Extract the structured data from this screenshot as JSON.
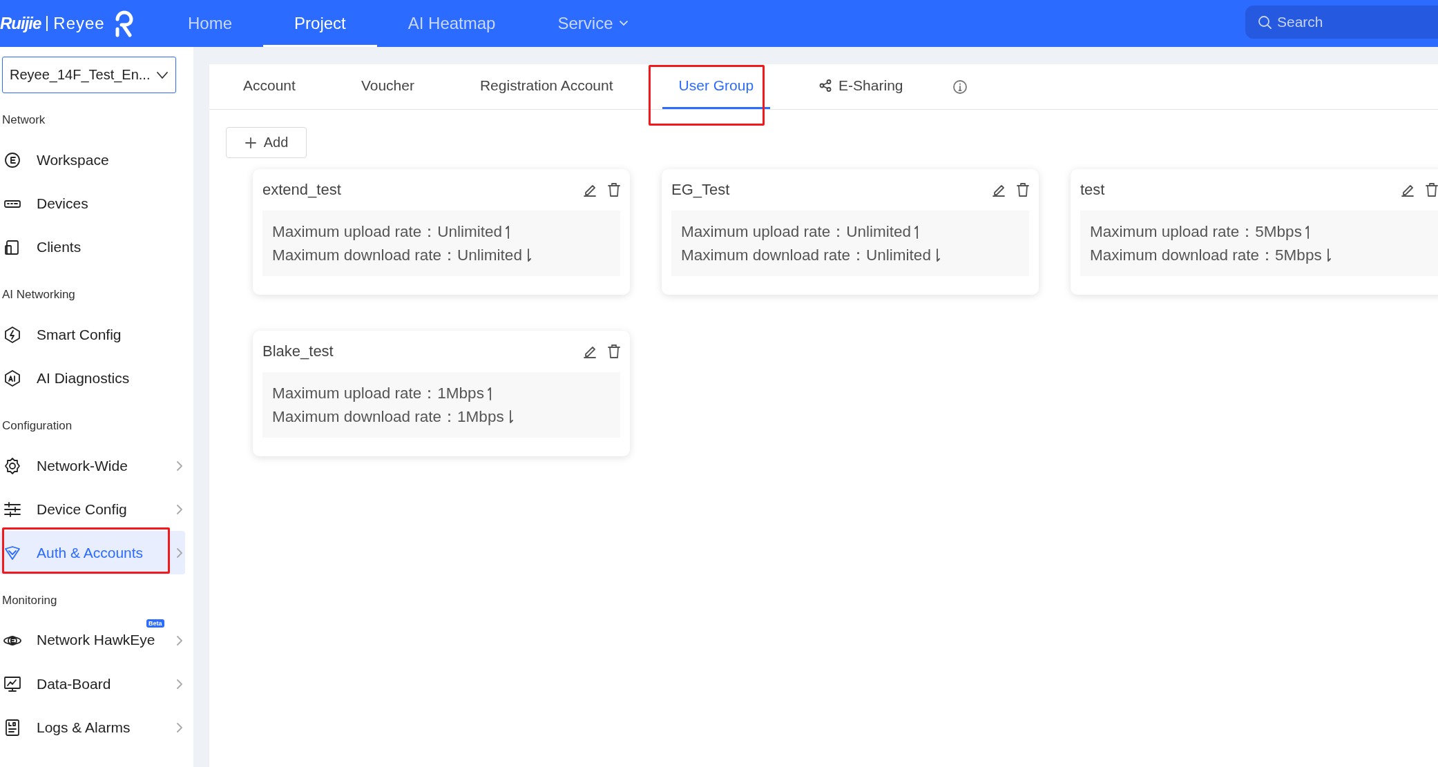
{
  "logo": {
    "brand": "Ruijie",
    "product": "Reyee"
  },
  "nav": [
    {
      "label": "Home",
      "selected": false,
      "kind": "link"
    },
    {
      "label": "Project",
      "selected": true,
      "kind": "link"
    },
    {
      "label": "AI Heatmap",
      "selected": false,
      "kind": "link"
    },
    {
      "label": "Service",
      "selected": false,
      "kind": "menu"
    }
  ],
  "search": {
    "placeholder": "Search"
  },
  "project_select": {
    "value": "Reyee_14F_Test_En..."
  },
  "sidebar": [
    {
      "section": "Network",
      "items": [
        {
          "label": "Workspace",
          "selected": false,
          "expandable": false,
          "annotated": false
        },
        {
          "label": "Devices",
          "selected": false,
          "expandable": false,
          "annotated": false
        },
        {
          "label": "Clients",
          "selected": false,
          "expandable": false,
          "annotated": false
        }
      ]
    },
    {
      "section": "AI Networking",
      "items": [
        {
          "label": "Smart Config",
          "selected": false,
          "expandable": false,
          "annotated": false
        },
        {
          "label": "AI Diagnostics",
          "selected": false,
          "expandable": false,
          "annotated": false
        }
      ]
    },
    {
      "section": "Configuration",
      "items": [
        {
          "label": "Network-Wide",
          "selected": false,
          "expandable": true,
          "annotated": false
        },
        {
          "label": "Device Config",
          "selected": false,
          "expandable": true,
          "annotated": false
        },
        {
          "label": "Auth & Accounts",
          "selected": true,
          "expandable": true,
          "annotated": true
        }
      ]
    },
    {
      "section": "Monitoring",
      "items": [
        {
          "label": "Network HawkEye",
          "selected": false,
          "expandable": true,
          "annotated": false,
          "badge": "Beta"
        },
        {
          "label": "Data-Board",
          "selected": false,
          "expandable": true,
          "annotated": false
        },
        {
          "label": "Logs & Alarms",
          "selected": false,
          "expandable": true,
          "annotated": false
        }
      ]
    }
  ],
  "tabs": [
    {
      "label": "Account",
      "selected": false,
      "annotated": false
    },
    {
      "label": "Voucher",
      "selected": false,
      "annotated": false
    },
    {
      "label": "Registration Account",
      "selected": false,
      "annotated": false
    },
    {
      "label": "User Group",
      "selected": true,
      "annotated": true
    },
    {
      "label": "E-Sharing",
      "selected": false,
      "annotated": false
    }
  ],
  "add_button": {
    "label": "Add"
  },
  "groups": [
    {
      "name": "extend_test",
      "rates": [
        {
          "label": "Maximum upload rate：",
          "value": "Unlimited"
        },
        {
          "label": "Maximum download rate：",
          "value": "Unlimited"
        }
      ]
    },
    {
      "name": "EG_Test",
      "rates": [
        {
          "label": "Maximum upload rate：",
          "value": "Unlimited"
        },
        {
          "label": "Maximum download rate：",
          "value": "Unlimited"
        }
      ]
    },
    {
      "name": "test",
      "rates": [
        {
          "label": "Maximum upload rate：",
          "value": "5Mbps"
        },
        {
          "label": "Maximum download rate：",
          "value": "5Mbps"
        }
      ]
    },
    {
      "name": "Blake_test",
      "rates": [
        {
          "label": "Maximum upload rate：",
          "value": "1Mbps"
        },
        {
          "label": "Maximum download rate：",
          "value": "1Mbps"
        }
      ]
    }
  ]
}
